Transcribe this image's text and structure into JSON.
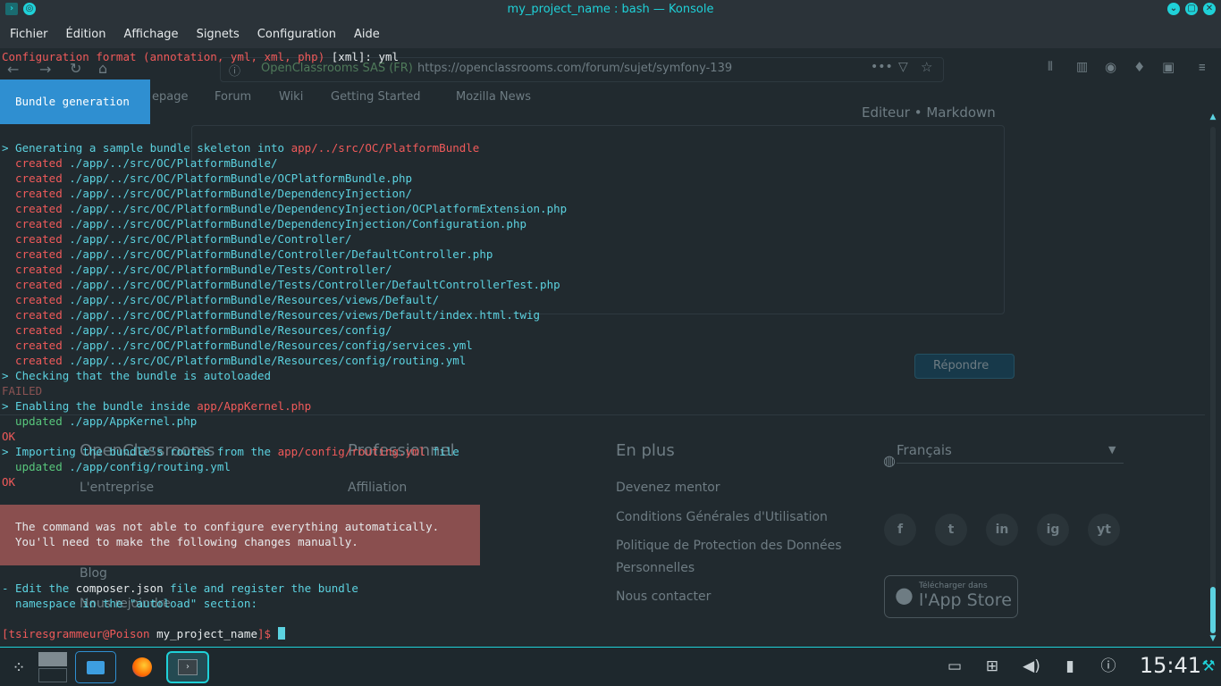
{
  "window": {
    "title": "my_project_name : bash — Konsole"
  },
  "menu": [
    "Fichier",
    "Édition",
    "Affichage",
    "Signets",
    "Configuration",
    "Aide"
  ],
  "terminal": {
    "line_config_prefix": "Configuration format (annotation, yml, xml, php) ",
    "line_config_default": "[xml]",
    "line_config_answer": ": yml",
    "bundle_box": "Bundle generation",
    "gen_prefix": "> Generating a sample bundle skeleton into ",
    "gen_path": "app/../src/OC/PlatformBundle",
    "created_label": "  created ",
    "created_files": [
      "./app/../src/OC/PlatformBundle/",
      "./app/../src/OC/PlatformBundle/OCPlatformBundle.php",
      "./app/../src/OC/PlatformBundle/DependencyInjection/",
      "./app/../src/OC/PlatformBundle/DependencyInjection/OCPlatformExtension.php",
      "./app/../src/OC/PlatformBundle/DependencyInjection/Configuration.php",
      "./app/../src/OC/PlatformBundle/Controller/",
      "./app/../src/OC/PlatformBundle/Controller/DefaultController.php",
      "./app/../src/OC/PlatformBundle/Tests/Controller/",
      "./app/../src/OC/PlatformBundle/Tests/Controller/DefaultControllerTest.php",
      "./app/../src/OC/PlatformBundle/Resources/views/Default/",
      "./app/../src/OC/PlatformBundle/Resources/views/Default/index.html.twig",
      "./app/../src/OC/PlatformBundle/Resources/config/",
      "./app/../src/OC/PlatformBundle/Resources/config/services.yml",
      "./app/../src/OC/PlatformBundle/Resources/config/routing.yml"
    ],
    "check_line": "> Checking that the bundle is autoloaded",
    "failed": "FAILED",
    "enable_prefix": "> Enabling the bundle inside ",
    "enable_path": "app/AppKernel.php",
    "updated_label": "  updated ",
    "updated_kernel": "./app/AppKernel.php",
    "ok": "OK",
    "import_prefix": "> Importing the bundle's routes from the ",
    "import_path": "app/config/routing.yml",
    "import_suffix": " file",
    "updated_routing": "./app/config/routing.yml",
    "error_line1": "The command was not able to configure everything automatically.",
    "error_line2": "You'll need to make the following changes manually.",
    "edit_prefix": "- Edit the ",
    "edit_file": "composer.json",
    "edit_suffix": " file and register the bundle",
    "edit_line2": "  namespace in the \"autoload\" section:",
    "prompt_user": "[tsiresgrammeur@Poison ",
    "prompt_dir": "my_project_name",
    "prompt_end": "]$ "
  },
  "ghost_browser": {
    "site_name": "OpenClassrooms SAS (FR)",
    "url": "https://openclassrooms.com/forum/sujet/symfony-139",
    "bookmarks": [
      "epage",
      "Forum",
      "Wiki",
      "Getting Started",
      "Mozilla News"
    ],
    "editor_label": "Editeur • Markdown",
    "reply_button": "Répondre",
    "footer_col1_title": "OpenClassrooms",
    "footer_col1_items": [
      "L'entreprise",
      "Blog",
      "Nous rejoindre"
    ],
    "footer_col2_title": "Professionnel",
    "footer_col2_items": [
      "Affiliation"
    ],
    "footer_col3_title": "En plus",
    "footer_col3_items": [
      "Devenez mentor",
      "Conditions Générales d'Utilisation",
      "Politique de Protection des Données",
      "Personnelles",
      "Nous contacter"
    ],
    "language": "Français",
    "social": [
      "f",
      "t",
      "in",
      "ig",
      "yt"
    ],
    "appstore_small": "Télécharger dans",
    "appstore_big": "l'App Store"
  },
  "taskbar": {
    "clock": "15:41"
  },
  "colors": {
    "accent": "#1fd1d8",
    "terminal_bg": "#212a2f",
    "red": "#f05a5a",
    "cyan": "#5cd2e0",
    "bundle_box": "#2f8fd1",
    "error_box": "#8a4f4f"
  }
}
